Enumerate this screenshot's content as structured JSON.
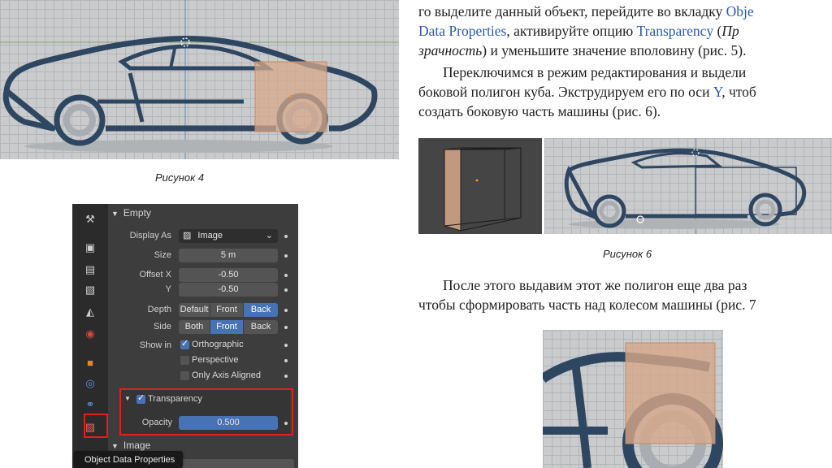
{
  "captions": {
    "fig4": "Рисунок 4",
    "fig6": "Рисунок 6"
  },
  "paragraph1": {
    "l1a": "го выделите данный объект, перейдите во вкладку ",
    "l1b": "Obje",
    "l2a": "Data Properties",
    "l2b": ", активируйте опцию ",
    "l2c": "Transparency",
    "l2d": " (",
    "l2e": "Пр",
    "l3a": "зрачность",
    "l3b": ") и уменьшите значение вполовину (рис. 5)."
  },
  "paragraph2": {
    "l1": "Переключимся в режим редактирования и выдели",
    "l2a": "боковой полигон куба. Экструдируем его по оси ",
    "l2b": "Y",
    "l2c": ", чтоб",
    "l3": "создать боковую часть машины (рис. 6)."
  },
  "paragraph3": {
    "l1": "После этого выдавим этот же полигон еще два раз",
    "l2": "чтобы сформировать часть над колесом машины (рис. 7"
  },
  "panel": {
    "empty_header": "Empty",
    "display_as_label": "Display As",
    "display_as_value": "Image",
    "size_label": "Size",
    "size_value": "5 m",
    "offset_x_label": "Offset X",
    "offset_x_value": "-0.50",
    "y_label": "Y",
    "y_value": "-0.50",
    "depth_label": "Depth",
    "depth_options": [
      "Default",
      "Front",
      "Back"
    ],
    "side_label": "Side",
    "side_options": [
      "Both",
      "Front",
      "Back"
    ],
    "show_in_label": "Show in",
    "orthographic": "Orthographic",
    "perspective": "Perspective",
    "only_axis_aligned": "Only Axis Aligned",
    "transparency_label": "Transparency",
    "opacity_label": "Opacity",
    "opacity_value": "0.500",
    "image_header": "Image",
    "tooltip": "Object Data Properties"
  },
  "colors": {
    "highlight": "#e0201c",
    "accent": "#4772b3",
    "link_blue": "#2a5aa8",
    "car_outline": "#2f4661",
    "overlay": "#d6a88a"
  }
}
